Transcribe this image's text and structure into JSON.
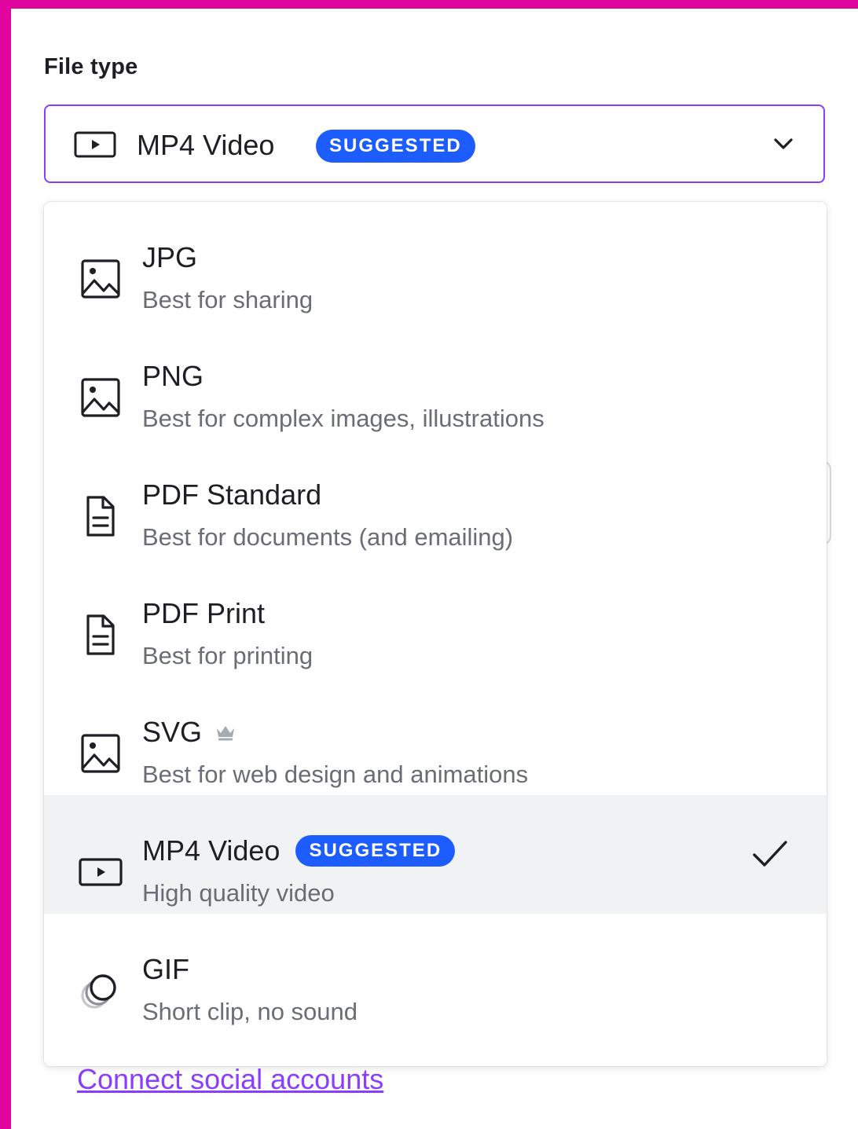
{
  "file_type": {
    "label": "File type",
    "selected_value": "MP4 Video",
    "selected_badge": "SUGGESTED",
    "selected_icon": "video-play-icon"
  },
  "options": [
    {
      "title": "JPG",
      "description": "Best for sharing",
      "icon": "image-icon"
    },
    {
      "title": "PNG",
      "description": "Best for complex images, illustrations",
      "icon": "image-icon"
    },
    {
      "title": "PDF Standard",
      "description": "Best for documents (and emailing)",
      "icon": "document-icon"
    },
    {
      "title": "PDF Print",
      "description": "Best for printing",
      "icon": "document-icon"
    },
    {
      "title": "SVG",
      "description": "Best for web design and animations",
      "icon": "image-icon",
      "premium_icon": "crown-icon"
    },
    {
      "title": "MP4 Video",
      "description": "High quality video",
      "icon": "video-play-icon",
      "badge": "SUGGESTED",
      "selected": true
    },
    {
      "title": "GIF",
      "description": "Short clip, no sound",
      "icon": "gif-circles-icon"
    }
  ],
  "footer": {
    "link_text": "Connect social accounts"
  },
  "colors": {
    "accent": "#8b3dff",
    "badge": "#1d5cff",
    "frame": "#e0059f",
    "selected_row": "#f1f2f4"
  }
}
